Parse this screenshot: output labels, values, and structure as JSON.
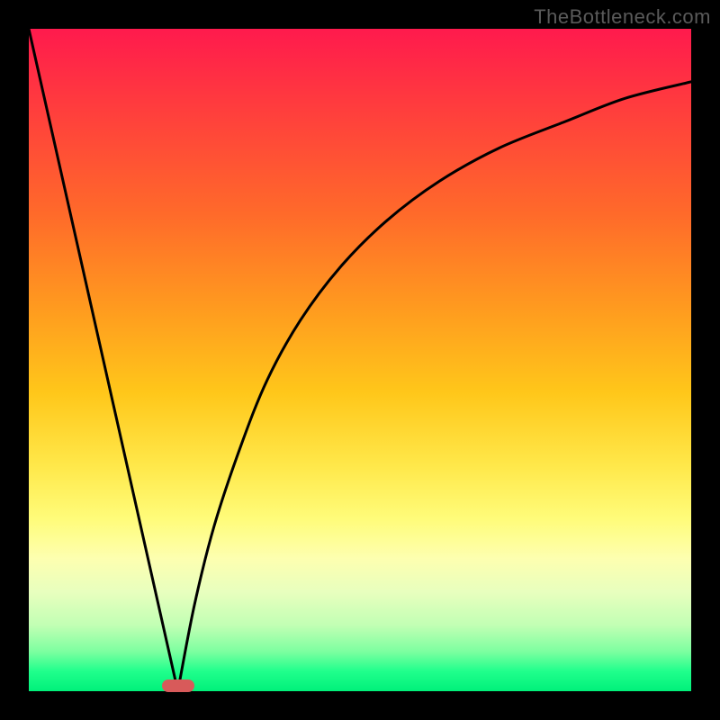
{
  "watermark": "TheBottleneck.com",
  "marker": {
    "color": "#d85a5a",
    "x_pct": 22.5,
    "y_pct": 99.2
  },
  "chart_data": {
    "type": "line",
    "title": "",
    "xlabel": "",
    "ylabel": "",
    "xlim": [
      0,
      100
    ],
    "ylim": [
      0,
      100
    ],
    "grid": false,
    "legend": false,
    "background": "red-yellow-green vertical gradient (red top, green bottom)",
    "annotations": [
      {
        "text": "TheBottleneck.com",
        "position": "top-right",
        "color": "#5a5a5a"
      }
    ],
    "series": [
      {
        "name": "left-segment",
        "type": "line",
        "x": [
          0,
          22.5
        ],
        "y": [
          100,
          0
        ],
        "stroke": "#000000",
        "description": "straight line from top-left down to the minimum"
      },
      {
        "name": "right-segment",
        "type": "line",
        "x": [
          22.5,
          25,
          28,
          32,
          36,
          41,
          47,
          54,
          62,
          71,
          81,
          90,
          100
        ],
        "y": [
          0,
          13,
          25,
          37,
          47,
          56,
          64,
          71,
          77,
          82,
          86,
          89.5,
          92
        ],
        "stroke": "#000000",
        "description": "concave curve rising from the minimum toward upper-right, flattening"
      }
    ],
    "marker": {
      "shape": "rounded-rect",
      "x": 22.5,
      "y": 0,
      "color": "#d85a5a"
    }
  }
}
